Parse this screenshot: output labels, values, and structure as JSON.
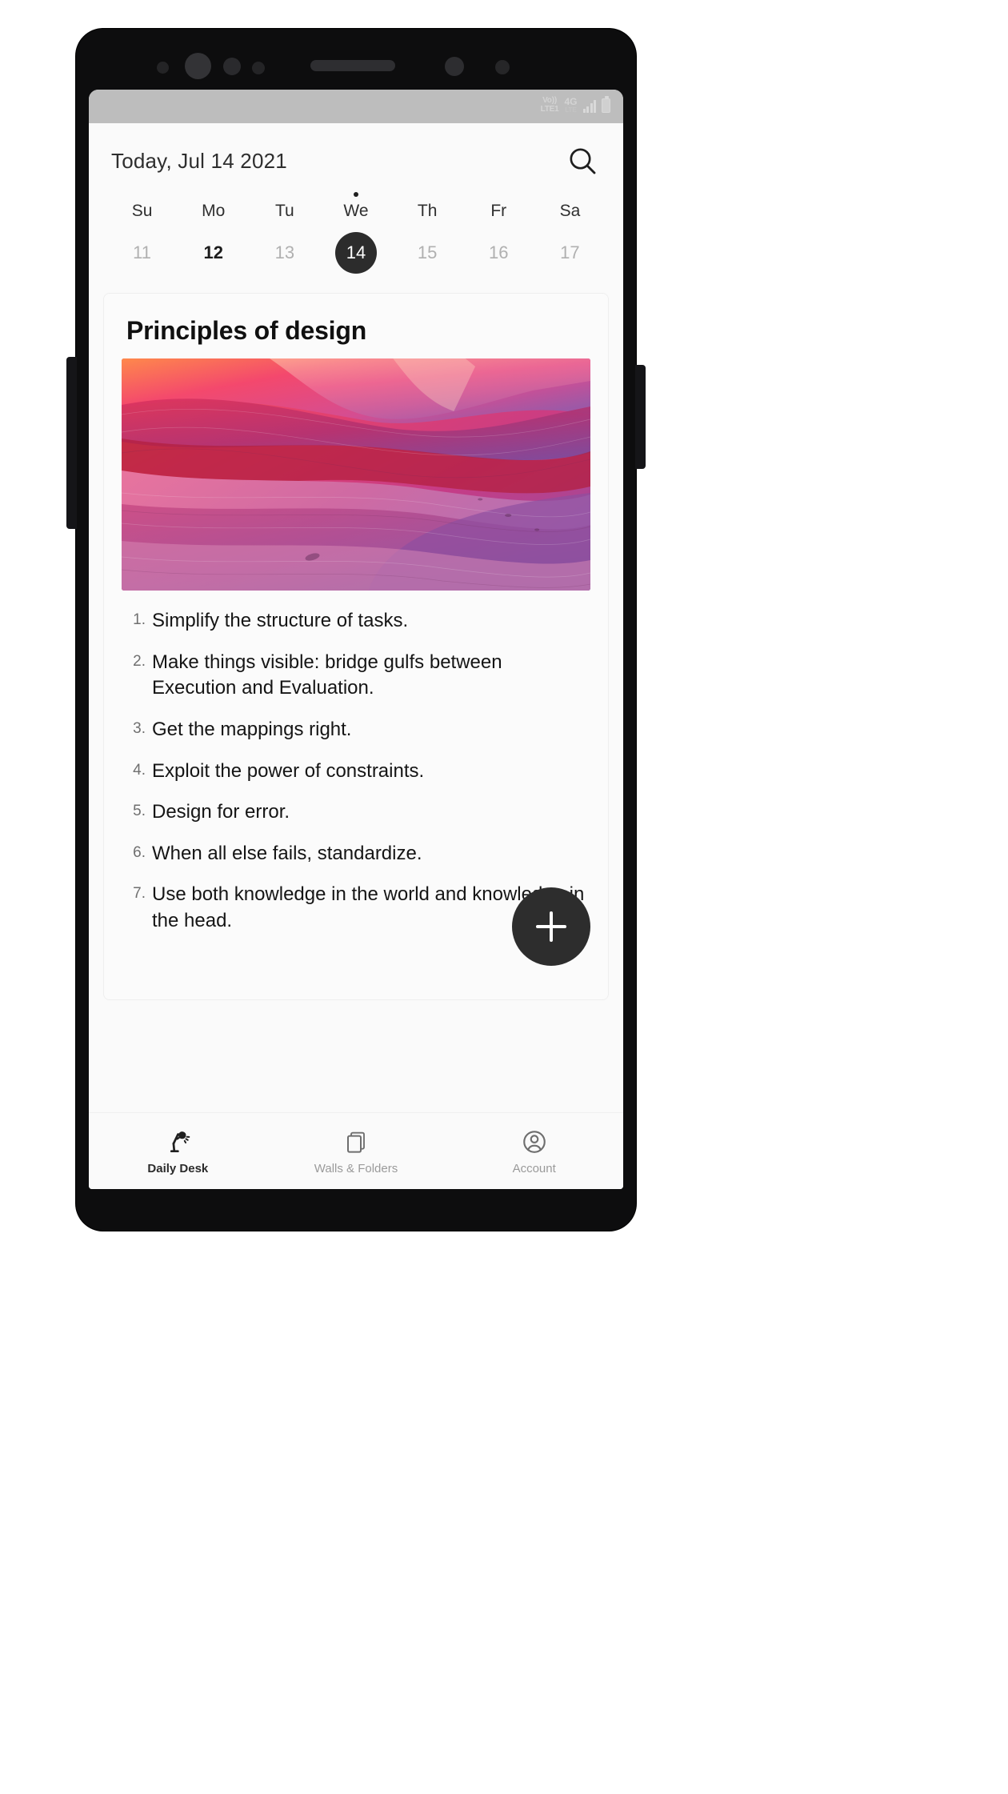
{
  "status_bar": {
    "volte_line1": "Vo))",
    "volte_line2": "LTE1",
    "network": "4G",
    "network_sub": "LTE",
    "signal_icon": "signal-bars-icon",
    "battery_icon": "battery-icon"
  },
  "header": {
    "today_label": "Today, Jul 14 2021",
    "search_icon": "search-icon"
  },
  "week": {
    "days": [
      {
        "dow": "Su",
        "num": "11",
        "today": false,
        "strong": false,
        "dot": false
      },
      {
        "dow": "Mo",
        "num": "12",
        "today": false,
        "strong": true,
        "dot": false
      },
      {
        "dow": "Tu",
        "num": "13",
        "today": false,
        "strong": false,
        "dot": false
      },
      {
        "dow": "We",
        "num": "14",
        "today": true,
        "strong": false,
        "dot": true
      },
      {
        "dow": "Th",
        "num": "15",
        "today": false,
        "strong": false,
        "dot": false
      },
      {
        "dow": "Fr",
        "num": "16",
        "today": false,
        "strong": false,
        "dot": false
      },
      {
        "dow": "Sa",
        "num": "17",
        "today": false,
        "strong": false,
        "dot": false
      }
    ]
  },
  "note": {
    "title": "Principles of design",
    "image_alt": "abstract-pink-orange-canyon-waves",
    "items": [
      {
        "num": "1.",
        "text": "Simplify the structure of tasks."
      },
      {
        "num": "2.",
        "text": "Make things visible: bridge gulfs between Execution and Evaluation."
      },
      {
        "num": "3.",
        "text": "Get the mappings right."
      },
      {
        "num": "4.",
        "text": "Exploit the power of constraints."
      },
      {
        "num": "5.",
        "text": "Design for error."
      },
      {
        "num": "6.",
        "text": "When all else fails, standardize."
      },
      {
        "num": "7.",
        "text": "Use both knowledge in the world and knowledge in the head."
      }
    ]
  },
  "fab": {
    "label": "+",
    "icon": "plus-icon"
  },
  "bottom_nav": {
    "items": [
      {
        "label": "Daily Desk",
        "icon": "desk-lamp-icon",
        "active": true
      },
      {
        "label": "Walls & Folders",
        "icon": "copy-cards-icon",
        "active": false
      },
      {
        "label": "Account",
        "icon": "user-circle-icon",
        "active": false
      }
    ]
  },
  "colors": {
    "accent_dark": "#2c2c2c",
    "screen_bg": "#fafafa",
    "status_bar_bg": "#bdbdbd",
    "muted_text": "#b0b0b0"
  }
}
